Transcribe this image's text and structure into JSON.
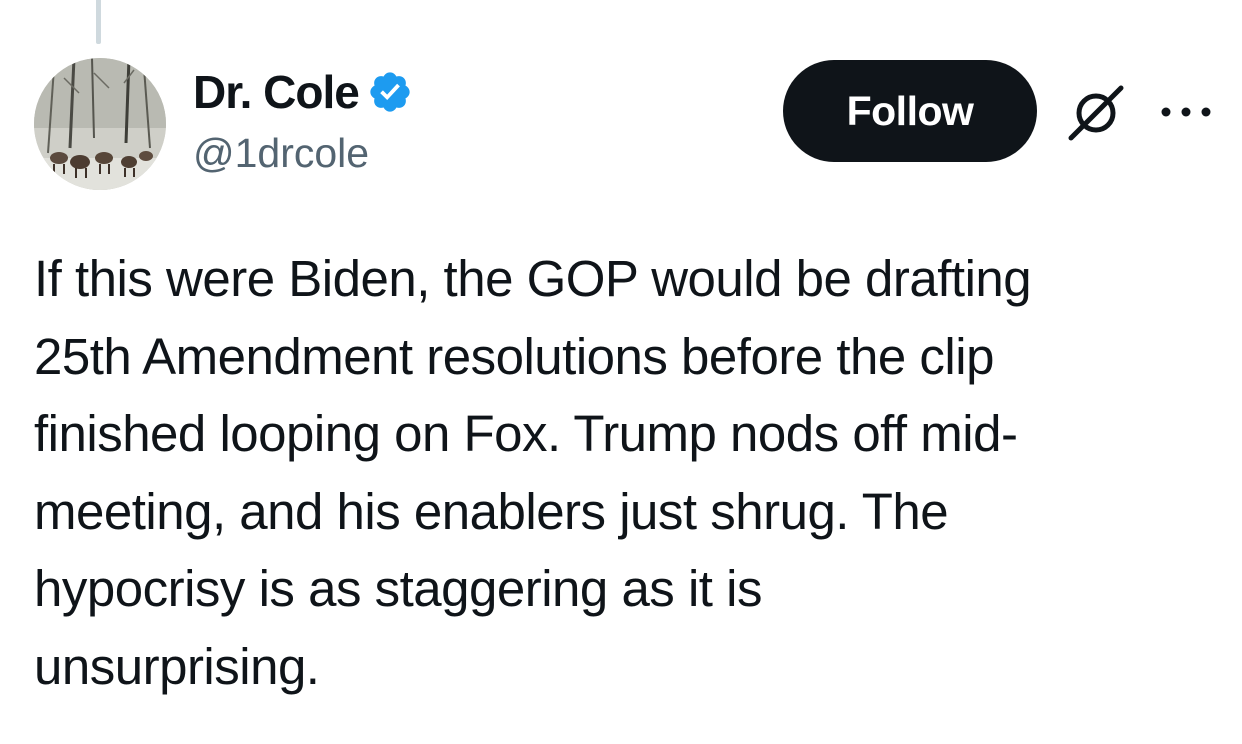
{
  "author": {
    "display_name": "Dr. Cole",
    "handle": "@1drcole",
    "verified": true,
    "avatar_icon": "deer-in-snow-avatar"
  },
  "actions": {
    "follow_label": "Follow",
    "grok_icon": "grok-icon",
    "more_icon": "more-options-icon"
  },
  "tweet": {
    "lines": [
      "If this were Biden, the GOP would be drafting",
      "25th Amendment resolutions before the clip",
      "finished looping on Fox. Trump nods off mid-",
      "meeting, and his enablers just shrug. The",
      "hypocrisy is as staggering as it is",
      "unsurprising."
    ]
  },
  "colors": {
    "text": "#0f1419",
    "secondary": "#536471",
    "verified_badge": "#1d9bf0",
    "button_bg": "#0f1419",
    "thread_line": "#cfd9de"
  }
}
